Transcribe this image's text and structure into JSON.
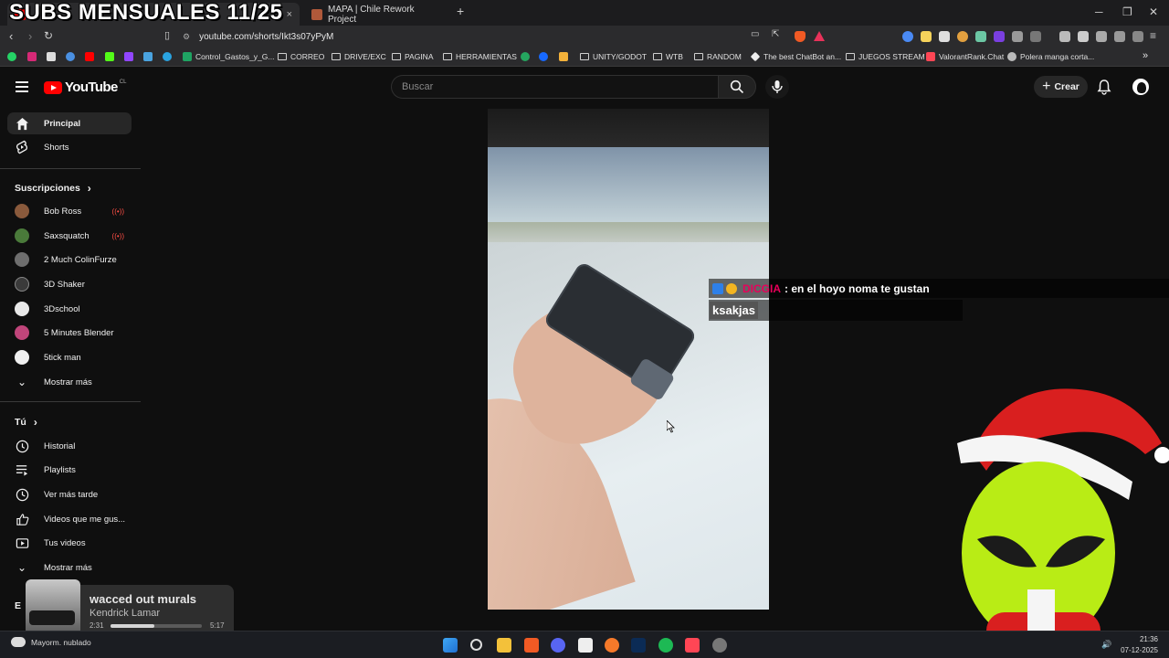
{
  "overlay": {
    "title": "SUBS MENSUALES 11/25"
  },
  "browser": {
    "tabs": [
      {
        "title": "",
        "active": true
      },
      {
        "title": "MAPA | Chile Rework Project",
        "active": false
      }
    ],
    "new_tab": "+",
    "close_tab": "×",
    "window": {
      "minimize": "─",
      "restore": "❐",
      "close": "✕"
    },
    "url": "youtube.com/shorts/Ikt3s07yPyM",
    "bookmarks": [
      "Control_Gastos_y_G...",
      "CORREO",
      "DRIVE/EXC",
      "PAGINA",
      "HERRAMIENTAS",
      "UNITY/GODOT",
      "WTB",
      "RANDOM",
      "The best ChatBot an...",
      "JUEGOS STREAM",
      "ValorantRank.Chat",
      "Polera manga corta..."
    ],
    "bookmarks_more": "»"
  },
  "youtube": {
    "logo": "YouTube",
    "country": "CL",
    "search_placeholder": "Buscar",
    "create_label": "Crear",
    "sidebar": {
      "main": [
        {
          "label": "Principal",
          "icon": "home-icon",
          "active": true
        },
        {
          "label": "Shorts",
          "icon": "shorts-icon",
          "active": false
        }
      ],
      "subs_heading": "Suscripciones",
      "subscriptions": [
        {
          "label": "Bob Ross",
          "live": true,
          "color": "#8a5a3c"
        },
        {
          "label": "Saxsquatch",
          "live": true,
          "color": "#4a7a3a"
        },
        {
          "label": "2 Much ColinFurze",
          "live": false,
          "color": "#6e6e6e"
        },
        {
          "label": "3D Shaker",
          "live": false,
          "color": "#3a3a3a"
        },
        {
          "label": "3Dschool",
          "live": false,
          "color": "#e8e8e8"
        },
        {
          "label": "5 Minutes Blender",
          "live": false,
          "color": "#c0457a"
        },
        {
          "label": "5tick man",
          "live": false,
          "color": "#f0f0f0"
        }
      ],
      "show_more": "Mostrar más",
      "you_heading": "Tú",
      "you_items": [
        {
          "label": "Historial",
          "icon": "history-icon"
        },
        {
          "label": "Playlists",
          "icon": "playlists-icon"
        },
        {
          "label": "Ver más tarde",
          "icon": "watch-later-icon"
        },
        {
          "label": "Videos que me gus...",
          "icon": "liked-icon"
        },
        {
          "label": "Tus videos",
          "icon": "your-videos-icon"
        }
      ],
      "show_more_2": "Mostrar más",
      "cut_heading": "E"
    }
  },
  "chat": {
    "user": "DICGIA",
    "message": ": en el hoyo noma te gustan",
    "message2": "ksakjas"
  },
  "now_playing": {
    "title": "wacced out murals",
    "artist": "Kendrick Lamar",
    "elapsed": "2:31",
    "duration": "5:17",
    "progress": 0.48
  },
  "taskbar": {
    "weather": "Mayorm. nublado",
    "time": "21:36",
    "date": "07-12-2025"
  }
}
